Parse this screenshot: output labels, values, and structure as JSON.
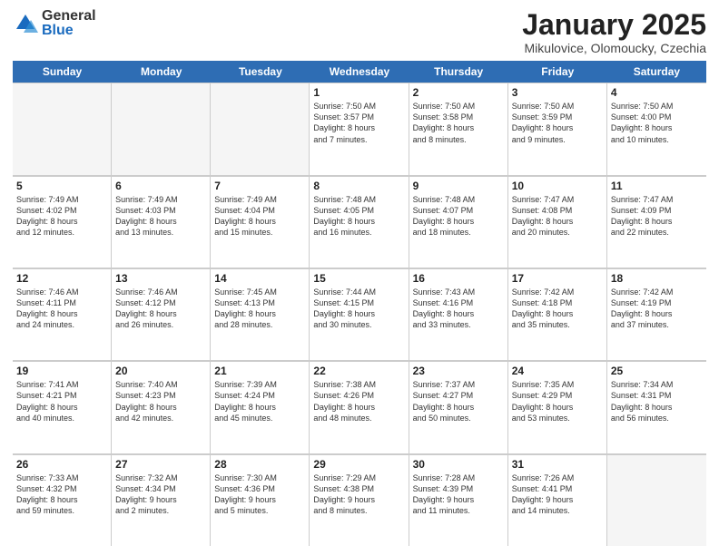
{
  "logo": {
    "general": "General",
    "blue": "Blue"
  },
  "title": "January 2025",
  "subtitle": "Mikulovice, Olomoucky, Czechia",
  "header_days": [
    "Sunday",
    "Monday",
    "Tuesday",
    "Wednesday",
    "Thursday",
    "Friday",
    "Saturday"
  ],
  "rows": [
    [
      {
        "day": "",
        "text": "",
        "empty": true
      },
      {
        "day": "",
        "text": "",
        "empty": true
      },
      {
        "day": "",
        "text": "",
        "empty": true
      },
      {
        "day": "1",
        "text": "Sunrise: 7:50 AM\nSunset: 3:57 PM\nDaylight: 8 hours\nand 7 minutes."
      },
      {
        "day": "2",
        "text": "Sunrise: 7:50 AM\nSunset: 3:58 PM\nDaylight: 8 hours\nand 8 minutes."
      },
      {
        "day": "3",
        "text": "Sunrise: 7:50 AM\nSunset: 3:59 PM\nDaylight: 8 hours\nand 9 minutes."
      },
      {
        "day": "4",
        "text": "Sunrise: 7:50 AM\nSunset: 4:00 PM\nDaylight: 8 hours\nand 10 minutes."
      }
    ],
    [
      {
        "day": "5",
        "text": "Sunrise: 7:49 AM\nSunset: 4:02 PM\nDaylight: 8 hours\nand 12 minutes."
      },
      {
        "day": "6",
        "text": "Sunrise: 7:49 AM\nSunset: 4:03 PM\nDaylight: 8 hours\nand 13 minutes."
      },
      {
        "day": "7",
        "text": "Sunrise: 7:49 AM\nSunset: 4:04 PM\nDaylight: 8 hours\nand 15 minutes."
      },
      {
        "day": "8",
        "text": "Sunrise: 7:48 AM\nSunset: 4:05 PM\nDaylight: 8 hours\nand 16 minutes."
      },
      {
        "day": "9",
        "text": "Sunrise: 7:48 AM\nSunset: 4:07 PM\nDaylight: 8 hours\nand 18 minutes."
      },
      {
        "day": "10",
        "text": "Sunrise: 7:47 AM\nSunset: 4:08 PM\nDaylight: 8 hours\nand 20 minutes."
      },
      {
        "day": "11",
        "text": "Sunrise: 7:47 AM\nSunset: 4:09 PM\nDaylight: 8 hours\nand 22 minutes."
      }
    ],
    [
      {
        "day": "12",
        "text": "Sunrise: 7:46 AM\nSunset: 4:11 PM\nDaylight: 8 hours\nand 24 minutes."
      },
      {
        "day": "13",
        "text": "Sunrise: 7:46 AM\nSunset: 4:12 PM\nDaylight: 8 hours\nand 26 minutes."
      },
      {
        "day": "14",
        "text": "Sunrise: 7:45 AM\nSunset: 4:13 PM\nDaylight: 8 hours\nand 28 minutes."
      },
      {
        "day": "15",
        "text": "Sunrise: 7:44 AM\nSunset: 4:15 PM\nDaylight: 8 hours\nand 30 minutes."
      },
      {
        "day": "16",
        "text": "Sunrise: 7:43 AM\nSunset: 4:16 PM\nDaylight: 8 hours\nand 33 minutes."
      },
      {
        "day": "17",
        "text": "Sunrise: 7:42 AM\nSunset: 4:18 PM\nDaylight: 8 hours\nand 35 minutes."
      },
      {
        "day": "18",
        "text": "Sunrise: 7:42 AM\nSunset: 4:19 PM\nDaylight: 8 hours\nand 37 minutes."
      }
    ],
    [
      {
        "day": "19",
        "text": "Sunrise: 7:41 AM\nSunset: 4:21 PM\nDaylight: 8 hours\nand 40 minutes."
      },
      {
        "day": "20",
        "text": "Sunrise: 7:40 AM\nSunset: 4:23 PM\nDaylight: 8 hours\nand 42 minutes."
      },
      {
        "day": "21",
        "text": "Sunrise: 7:39 AM\nSunset: 4:24 PM\nDaylight: 8 hours\nand 45 minutes."
      },
      {
        "day": "22",
        "text": "Sunrise: 7:38 AM\nSunset: 4:26 PM\nDaylight: 8 hours\nand 48 minutes."
      },
      {
        "day": "23",
        "text": "Sunrise: 7:37 AM\nSunset: 4:27 PM\nDaylight: 8 hours\nand 50 minutes."
      },
      {
        "day": "24",
        "text": "Sunrise: 7:35 AM\nSunset: 4:29 PM\nDaylight: 8 hours\nand 53 minutes."
      },
      {
        "day": "25",
        "text": "Sunrise: 7:34 AM\nSunset: 4:31 PM\nDaylight: 8 hours\nand 56 minutes."
      }
    ],
    [
      {
        "day": "26",
        "text": "Sunrise: 7:33 AM\nSunset: 4:32 PM\nDaylight: 8 hours\nand 59 minutes."
      },
      {
        "day": "27",
        "text": "Sunrise: 7:32 AM\nSunset: 4:34 PM\nDaylight: 9 hours\nand 2 minutes."
      },
      {
        "day": "28",
        "text": "Sunrise: 7:30 AM\nSunset: 4:36 PM\nDaylight: 9 hours\nand 5 minutes."
      },
      {
        "day": "29",
        "text": "Sunrise: 7:29 AM\nSunset: 4:38 PM\nDaylight: 9 hours\nand 8 minutes."
      },
      {
        "day": "30",
        "text": "Sunrise: 7:28 AM\nSunset: 4:39 PM\nDaylight: 9 hours\nand 11 minutes."
      },
      {
        "day": "31",
        "text": "Sunrise: 7:26 AM\nSunset: 4:41 PM\nDaylight: 9 hours\nand 14 minutes."
      },
      {
        "day": "",
        "text": "",
        "empty": true
      }
    ]
  ]
}
